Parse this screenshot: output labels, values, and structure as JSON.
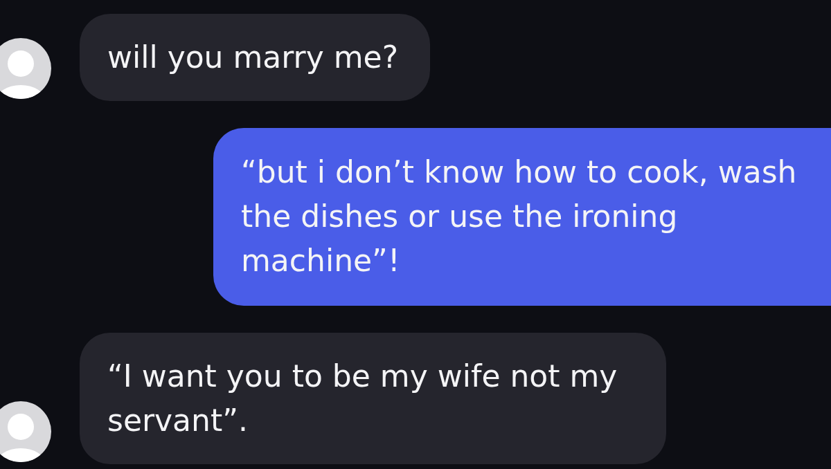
{
  "messages": [
    {
      "kind": "received",
      "text": "will you marry me?"
    },
    {
      "kind": "sent",
      "text": "“but i don’t know how to cook, wash the dishes or use the ironing machine”!"
    },
    {
      "kind": "received",
      "text": "“I want you to be my wife not my servant”."
    }
  ]
}
